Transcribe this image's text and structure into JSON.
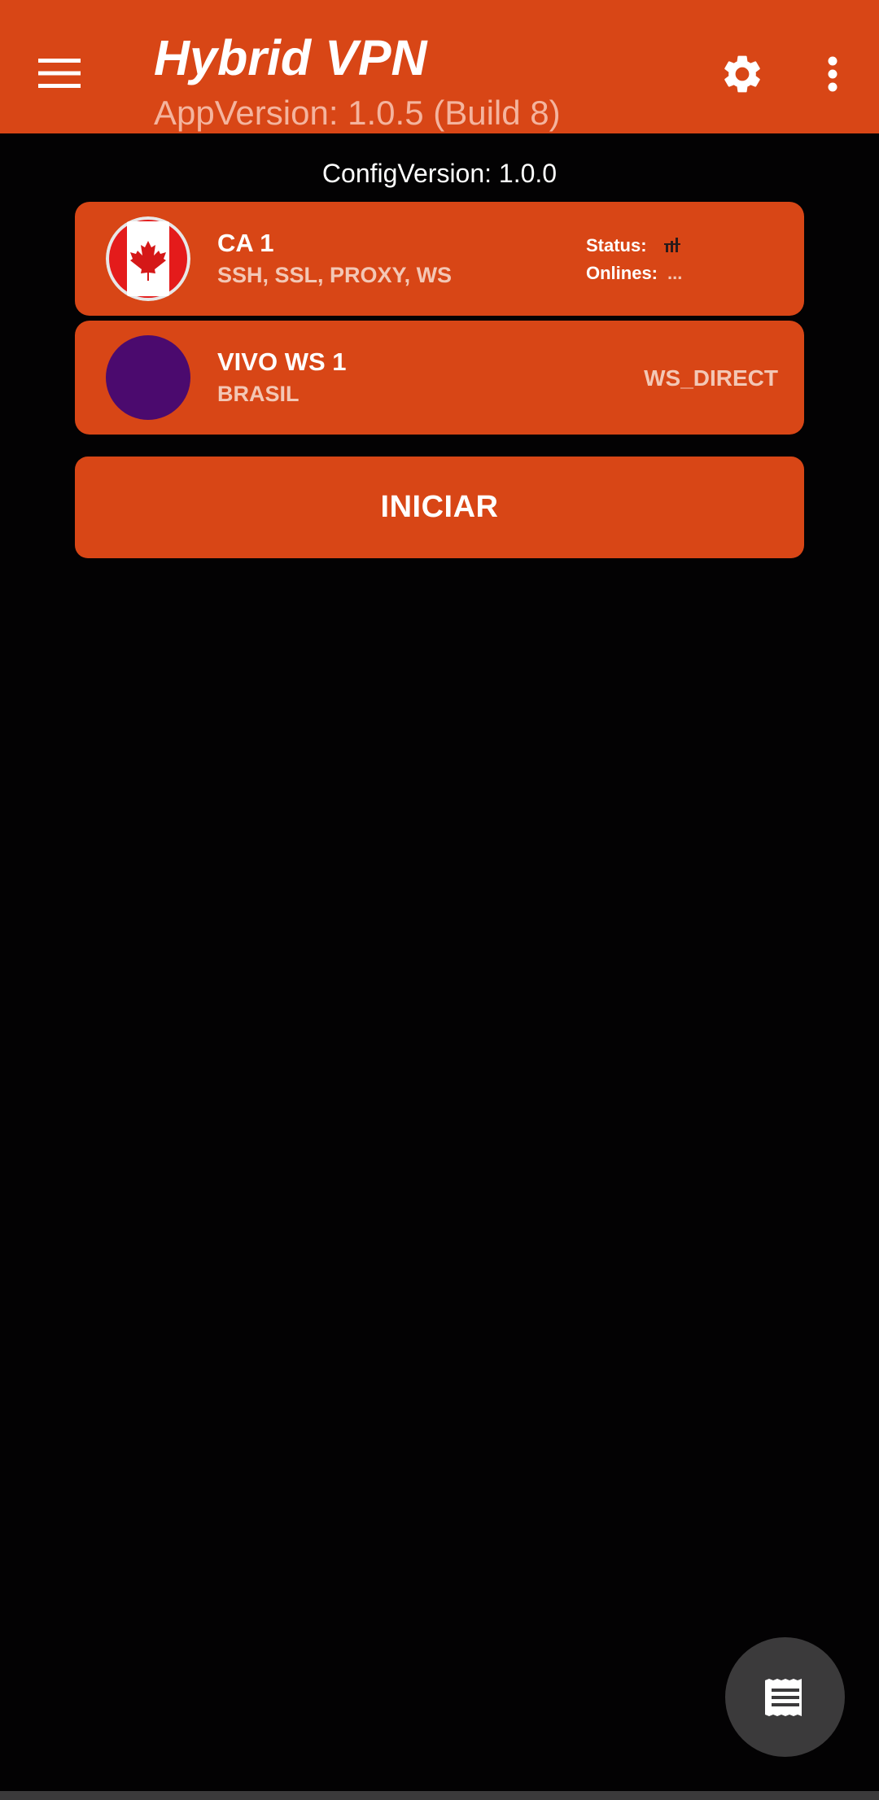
{
  "appbar": {
    "title": "Hybrid VPN",
    "subtitle": "AppVersion: 1.0.5 (Build 8)",
    "menu_icon": "hamburger-menu-icon",
    "settings_icon": "gear-icon",
    "more_icon": "more-vertical-icon"
  },
  "config_version": "ConfigVersion: 1.0.0",
  "servers": [
    {
      "name": "CA 1",
      "protocols": "SSH, SSL, PROXY, WS",
      "flag_icon": "canada-flag-icon",
      "status_label": "Status:",
      "status_icon": "signal-loading-icon",
      "onlines_label": "Onlines:",
      "onlines_value": "..."
    },
    {
      "name": "VIVO WS 1",
      "country": "BRASIL",
      "mode": "WS_DIRECT",
      "avatar_color": "#4b0a6e"
    }
  ],
  "start_button": "INICIAR",
  "fab_icon": "receipt-log-icon",
  "colors": {
    "primary": "#d84616",
    "background": "#030203",
    "fab": "#3b3a3b"
  }
}
